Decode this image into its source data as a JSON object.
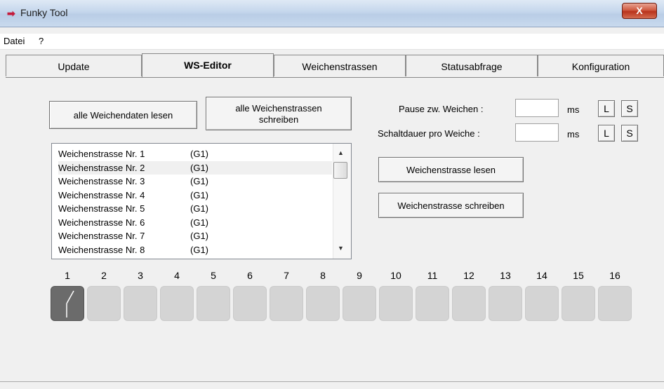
{
  "window": {
    "title": "Funky Tool",
    "close_label": "X",
    "icon": "red-arrow-icon"
  },
  "menu": [
    "Datei",
    "?"
  ],
  "tabs": [
    "Update",
    "WS-Editor",
    "Weichenstrassen",
    "Statusabfrage",
    "Konfiguration"
  ],
  "active_tab": "WS-Editor",
  "buttons": {
    "read_all": "alle Weichendaten lesen",
    "write_all_line1": "alle Weichenstrassen",
    "write_all_line2": "schreiben",
    "ws_read": "Weichenstrasse lesen",
    "ws_write": "Weichenstrasse schreiben"
  },
  "settings": {
    "pause_label": "Pause zw. Weichen :",
    "duration_label": "Schaltdauer pro Weiche :",
    "pause_value": "",
    "duration_value": "",
    "unit": "ms",
    "load": "L",
    "save": "S"
  },
  "list": {
    "selected_index": 1,
    "items": [
      {
        "name": "Weichenstrasse Nr. 1",
        "group": "(G1)"
      },
      {
        "name": "Weichenstrasse Nr. 2",
        "group": "(G1)"
      },
      {
        "name": "Weichenstrasse Nr. 3",
        "group": "(G1)"
      },
      {
        "name": "Weichenstrasse Nr. 4",
        "group": "(G1)"
      },
      {
        "name": "Weichenstrasse Nr. 5",
        "group": "(G1)"
      },
      {
        "name": "Weichenstrasse Nr. 6",
        "group": "(G1)"
      },
      {
        "name": "Weichenstrasse Nr. 7",
        "group": "(G1)"
      },
      {
        "name": "Weichenstrasse Nr. 8",
        "group": "(G1)"
      }
    ]
  },
  "switches": {
    "numbers": [
      "1",
      "2",
      "3",
      "4",
      "5",
      "6",
      "7",
      "8",
      "9",
      "10",
      "11",
      "12",
      "13",
      "14",
      "15",
      "16"
    ],
    "active_index": 0,
    "active_icon": "switch-diverging-icon"
  }
}
